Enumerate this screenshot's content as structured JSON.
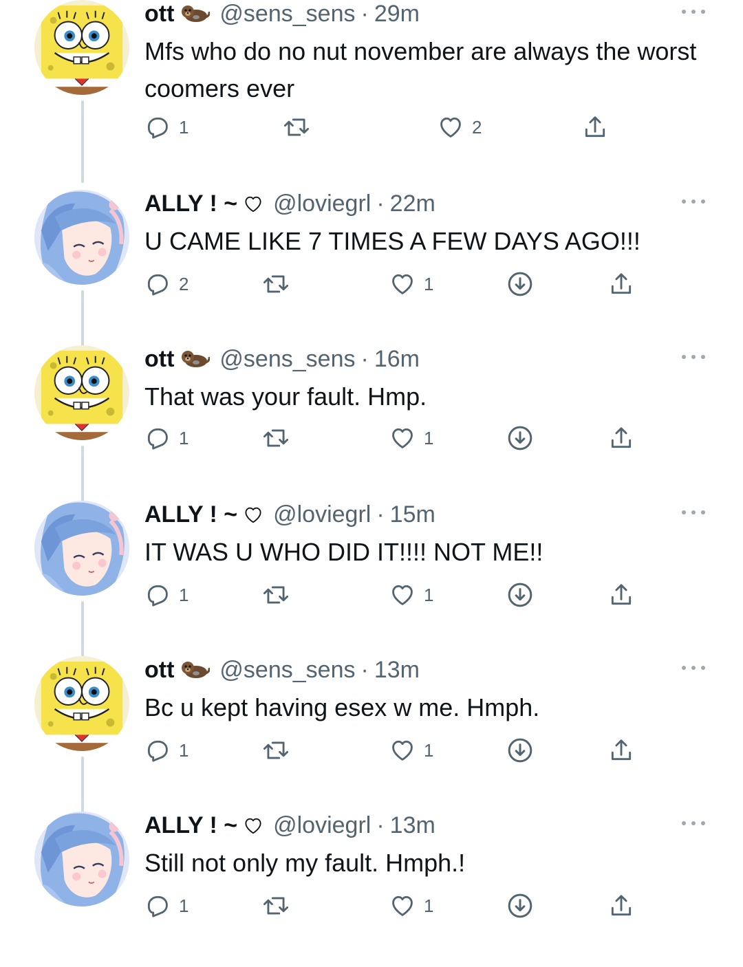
{
  "colors": {
    "text_primary": "#0f1419",
    "text_secondary": "#536471",
    "thread_line": "#cfd9de",
    "icon_gray": "#536471"
  },
  "tweets": [
    {
      "display_name": "ott",
      "name_emoji": "otter-emoji",
      "handle": "@sens_sens",
      "separator": "·",
      "time": "29m",
      "text": "Mfs who do no nut november are always the worst coomers ever",
      "reply_count": "1",
      "like_count": "2",
      "avatar": "spongebob-avatar"
    },
    {
      "display_name": "ALLY ! ~",
      "name_emoji": "heart-outline",
      "handle": "@loviegrl",
      "separator": "·",
      "time": "22m",
      "text": "U CAME LIKE 7 TIMES A FEW DAYS AGO!!!",
      "reply_count": "2",
      "like_count": "1",
      "avatar": "anime-girl-avatar"
    },
    {
      "display_name": "ott",
      "name_emoji": "otter-emoji",
      "handle": "@sens_sens",
      "separator": "·",
      "time": "16m",
      "text": "That was your fault. Hmp.",
      "reply_count": "1",
      "like_count": "1",
      "avatar": "spongebob-avatar"
    },
    {
      "display_name": "ALLY ! ~",
      "name_emoji": "heart-outline",
      "handle": "@loviegrl",
      "separator": "·",
      "time": "15m",
      "text": "IT WAS U WHO DID IT!!!! NOT ME!!",
      "reply_count": "1",
      "like_count": "1",
      "avatar": "anime-girl-avatar"
    },
    {
      "display_name": "ott",
      "name_emoji": "otter-emoji",
      "handle": "@sens_sens",
      "separator": "·",
      "time": "13m",
      "text": "Bc u kept having esex w me. Hmph.",
      "reply_count": "1",
      "like_count": "1",
      "avatar": "spongebob-avatar"
    },
    {
      "display_name": "ALLY ! ~",
      "name_emoji": "heart-outline",
      "handle": "@loviegrl",
      "separator": "·",
      "time": "13m",
      "text": "Still not only my fault. Hmph.!",
      "reply_count": "1",
      "like_count": "1",
      "avatar": "anime-girl-avatar"
    }
  ]
}
